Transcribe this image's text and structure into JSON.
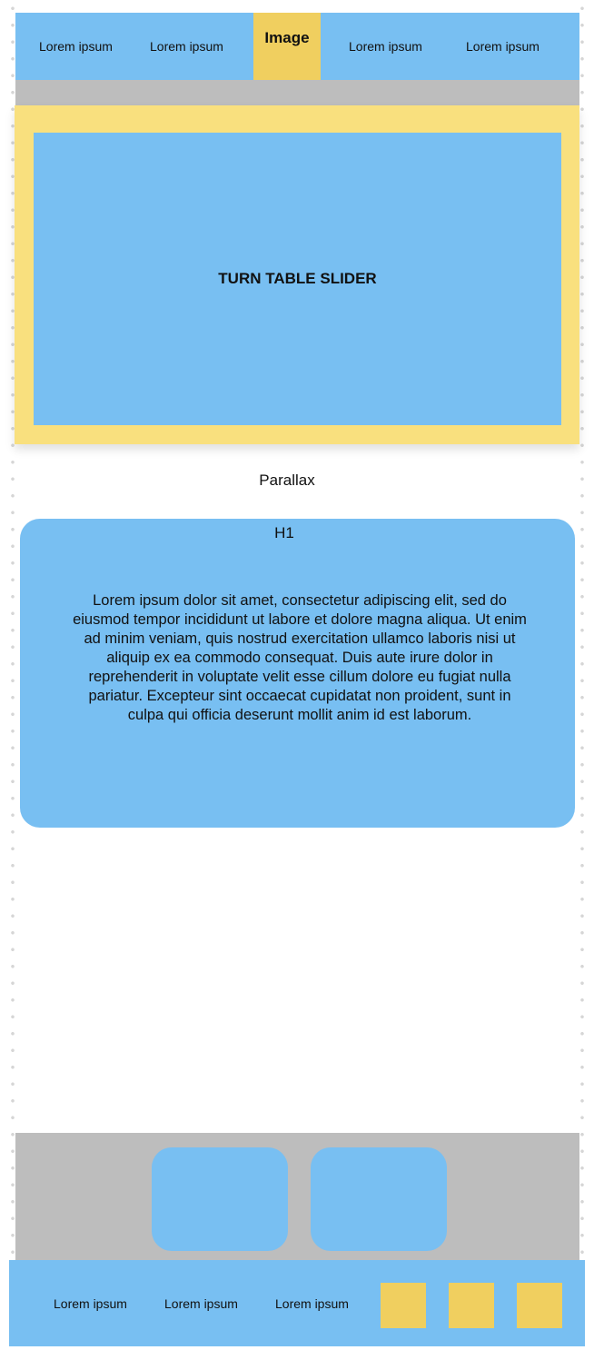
{
  "nav": {
    "items": [
      "Lorem ipsum",
      "Lorem ipsum",
      "Lorem ipsum",
      "Lorem ipsum"
    ],
    "logo_label": "Image"
  },
  "slider": {
    "title": "TURN TABLE SLIDER"
  },
  "parallax": {
    "label": "Parallax"
  },
  "card": {
    "heading": "H1",
    "body": "Lorem ipsum dolor sit amet, consectetur adipiscing elit, sed do eiusmod tempor incididunt ut labore et dolore magna aliqua. Ut enim ad minim veniam, quis nostrud exercitation ullamco laboris nisi ut aliquip ex ea commodo consequat. Duis aute irure dolor in reprehenderit in voluptate velit esse cillum dolore eu fugiat nulla pariatur. Excepteur sint occaecat cupidatat non proident, sunt in culpa qui officia deserunt mollit anim id est laborum."
  },
  "footer": {
    "links": [
      "Lorem ipsum",
      "Lorem ipsum",
      "Lorem ipsum"
    ]
  },
  "colors": {
    "blue": "#78bff2",
    "yellow": "#f0cf5f",
    "light_yellow": "#f9e07e",
    "gray": "#bdbdbd"
  }
}
